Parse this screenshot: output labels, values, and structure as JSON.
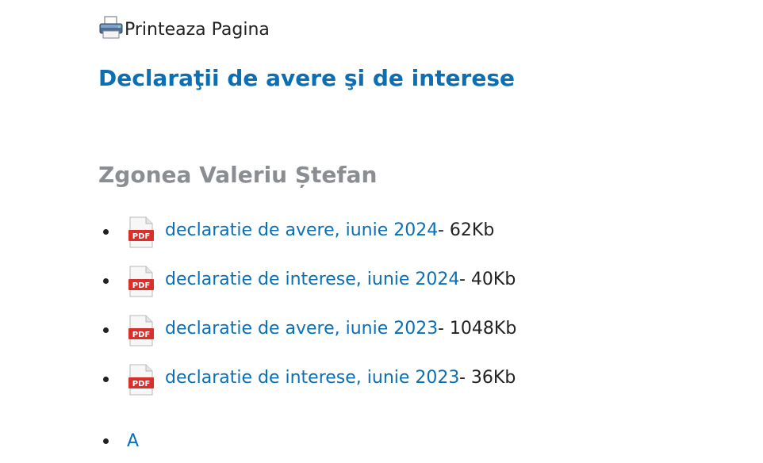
{
  "print": {
    "label": "Printeaza Pagina",
    "icon": "printer-icon"
  },
  "page_title": "Declaraţii de avere şi de interese",
  "person": {
    "name": "Zgonea Valeriu Ștefan"
  },
  "documents": [
    {
      "label": "declaratie de avere, iunie 2024",
      "size": " - 62Kb",
      "icon": "pdf-file-icon"
    },
    {
      "label": "declaratie de interese, iunie 2024",
      "size": " - 40Kb",
      "icon": "pdf-file-icon"
    },
    {
      "label": "declaratie de avere, iunie 2023",
      "size": " - 1048Kb",
      "icon": "pdf-file-icon"
    },
    {
      "label": "declaratie de interese, iunie 2023",
      "size": " - 36Kb",
      "icon": "pdf-file-icon"
    }
  ],
  "index_letter": "A",
  "colors": {
    "link": "#0a6fb5",
    "name": "#8a8d91",
    "text": "#222222",
    "pdf_red": "#d9302c"
  }
}
